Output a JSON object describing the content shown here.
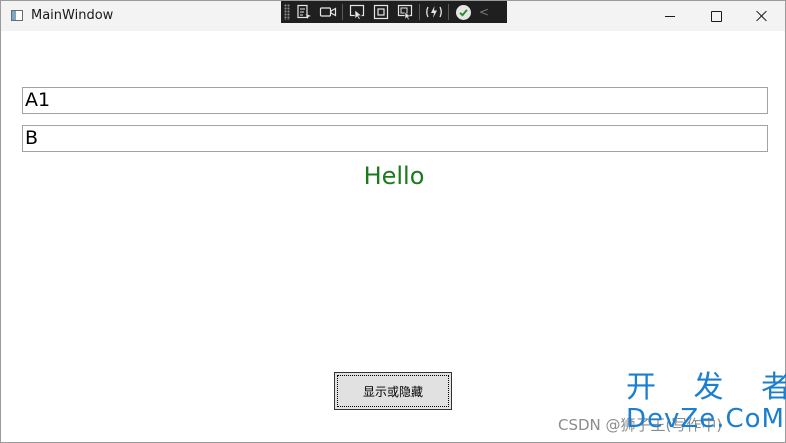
{
  "window": {
    "title": "MainWindow",
    "icon": "app-window-icon",
    "controls": {
      "minimize": "minimize-icon",
      "maximize": "maximize-icon",
      "close": "close-icon"
    }
  },
  "debug_toolbar": {
    "icons": [
      "live-visual-tree-icon",
      "record-icon",
      "select-element-icon",
      "display-layout-adorners-icon",
      "track-focus-icon",
      "hot-reload-icon",
      "check-icon",
      "collapse-chevron-icon"
    ],
    "chevron": "<"
  },
  "textbox1": {
    "value": "A1"
  },
  "textbox2": {
    "value": "B"
  },
  "hello_label": {
    "text": "Hello",
    "color": "#1b7a1b"
  },
  "toggle_button": {
    "label": "显示或隐藏"
  },
  "watermark": {
    "csdn": "CSDN @狮子王(写作中)",
    "logo_cn": "开 发 者",
    "logo_en": "DevZe.CoM",
    "color": "#1a7fd0"
  }
}
